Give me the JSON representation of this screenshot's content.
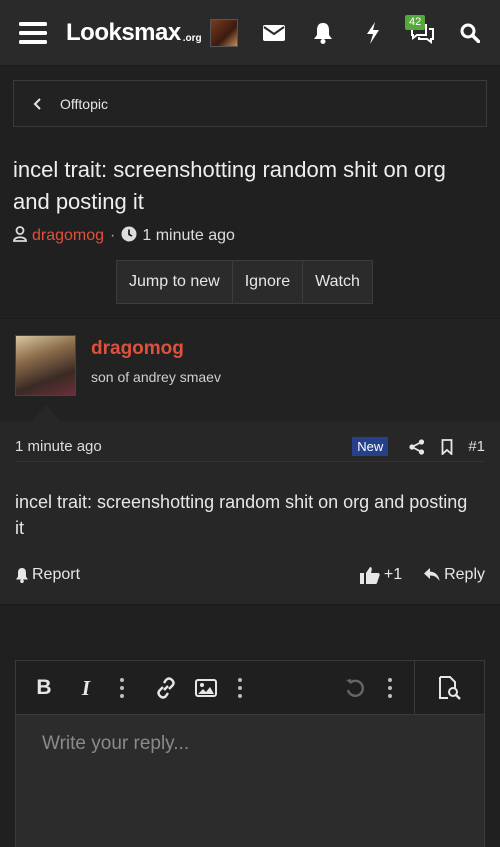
{
  "header": {
    "logo_brand": "Looksmax",
    "logo_tld": ".org",
    "convo_badge": "42",
    "icons": [
      "menu-icon",
      "mail-icon",
      "bell-icon",
      "bolt-icon",
      "conversation-icon",
      "search-icon"
    ]
  },
  "breadcrumb": {
    "label": "Offtopic"
  },
  "thread": {
    "title": "incel trait: screenshotting random shit on org and posting it",
    "author": "dragomog",
    "time": "1 minute ago",
    "buttons": [
      "Jump to new",
      "Ignore",
      "Watch"
    ]
  },
  "post": {
    "username": "dragomog",
    "user_title": "son of andrey smaev",
    "time": "1 minute ago",
    "new_label": "New",
    "number": "#1",
    "body": "incel trait: screenshotting random shit on org and posting it",
    "report_label": "Report",
    "like_count": "+1",
    "reply_label": "Reply"
  },
  "editor": {
    "placeholder": "Write your reply...",
    "bold_label": "B",
    "italic_label": "I"
  },
  "colors": {
    "accent_username": "#e0513c",
    "badge_green": "#56a83a",
    "new_badge": "#27408b",
    "background": "#202020"
  }
}
